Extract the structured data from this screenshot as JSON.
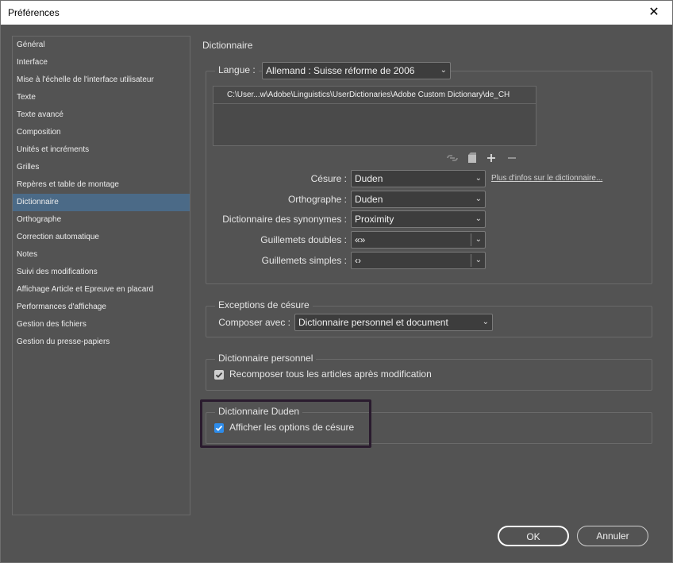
{
  "window": {
    "title": "Préférences",
    "close_glyph": "✕"
  },
  "sidebar": {
    "items": [
      "Général",
      "Interface",
      "Mise à l'échelle de l'interface utilisateur",
      "Texte",
      "Texte avancé",
      "Composition",
      "Unités et incréments",
      "Grilles",
      "Repères et table de montage",
      "Dictionnaire",
      "Orthographe",
      "Correction automatique",
      "Notes",
      "Suivi des modifications",
      "Affichage Article et Epreuve en placard",
      "Performances d'affichage",
      "Gestion des fichiers",
      "Gestion du presse-papiers"
    ],
    "selected": "Dictionnaire"
  },
  "main": {
    "title": "Dictionnaire",
    "langue": {
      "label": "Langue :",
      "value": "Allemand : Suisse réforme de 2006",
      "dictionaries": [
        "C:\\User...w\\Adobe\\Linguistics\\UserDictionaries\\Adobe Custom Dictionary\\de_CH"
      ]
    },
    "fields": {
      "cesure": {
        "label": "Césure :",
        "value": "Duden"
      },
      "orthographe": {
        "label": "Orthographe :",
        "value": "Duden"
      },
      "synonymes": {
        "label": "Dictionnaire des synonymes :",
        "value": "Proximity"
      },
      "guillemets_doubles": {
        "label": "Guillemets doubles :",
        "value": "«»"
      },
      "guillemets_simples": {
        "label": "Guillemets simples :",
        "value": "‹›"
      }
    },
    "more_info_link": "Plus d'infos sur le dictionnaire...",
    "exceptions": {
      "legend": "Exceptions de césure",
      "label": "Composer avec :",
      "value": "Dictionnaire personnel et document"
    },
    "personnel": {
      "legend": "Dictionnaire personnel",
      "checkbox_label": "Recomposer tous les articles après modification",
      "checked": true
    },
    "duden": {
      "legend": "Dictionnaire Duden",
      "checkbox_label": "Afficher les options de césure",
      "checked": true
    }
  },
  "buttons": {
    "ok": "OK",
    "cancel": "Annuler"
  },
  "colors": {
    "selection": "#4b6a87",
    "checkbox_accent": "#2d8ceb",
    "highlight_border": "#2a1b2e"
  }
}
